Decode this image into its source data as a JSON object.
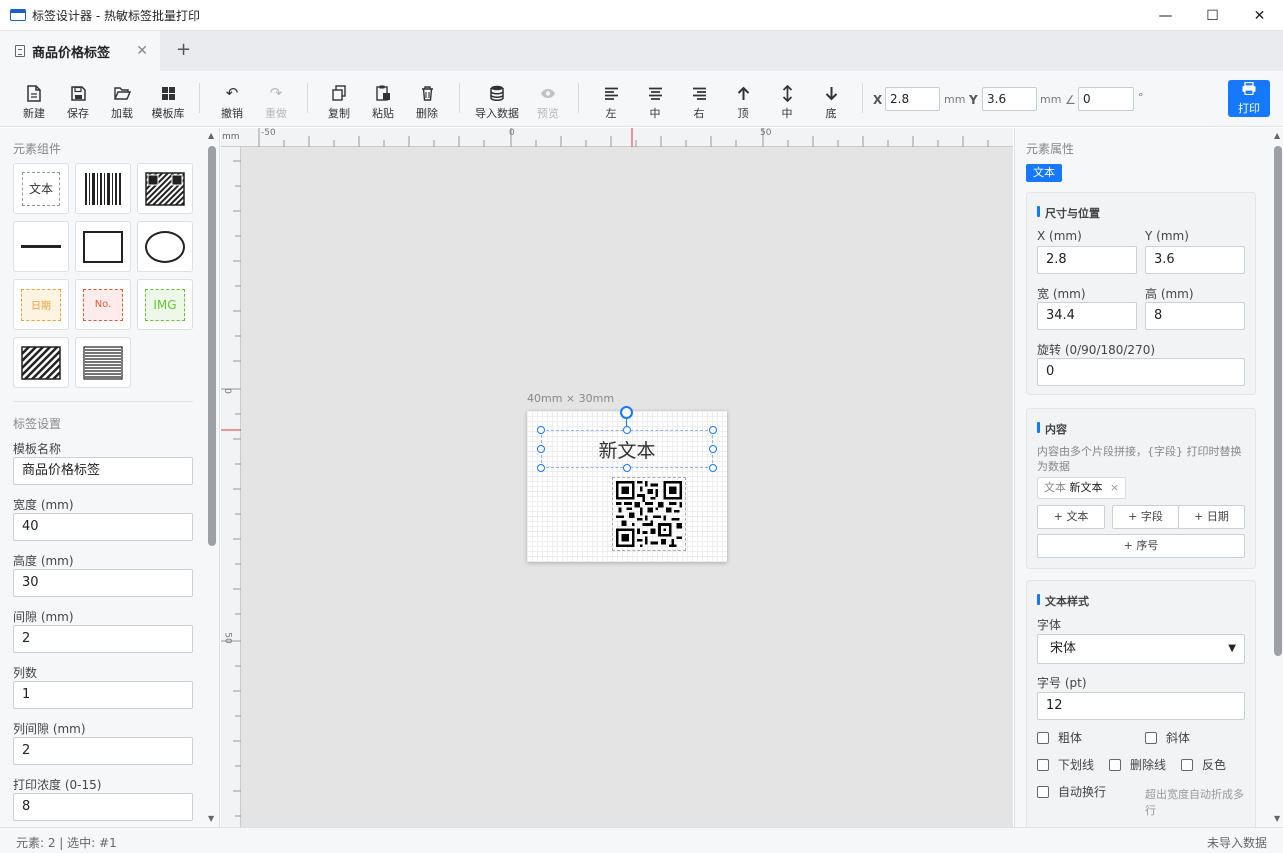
{
  "window": {
    "title": "标签设计器 - 热敏标签批量打印",
    "controls": [
      "—",
      "☐",
      "✕"
    ]
  },
  "tabs": {
    "active_label": "商品价格标签",
    "close_glyph": "✕",
    "add_glyph": "+"
  },
  "toolbar": {
    "new": "新建",
    "save": "保存",
    "load": "加载",
    "templates": "模板库",
    "undo": "撤销",
    "redo": "重做",
    "copy": "复制",
    "paste": "粘贴",
    "delete": "删除",
    "import_data": "导入数据",
    "preview": "预览",
    "align_left": "左",
    "align_center": "中",
    "align_right": "右",
    "align_top": "顶",
    "align_middle": "中",
    "align_bottom": "底",
    "x_label": "X",
    "x_value": "2.8",
    "x_unit": "mm",
    "y_label": "Y",
    "y_value": "3.6",
    "y_unit": "mm",
    "angle_symbol": "∠",
    "angle_value": "0",
    "angle_unit": "°",
    "print": "打印"
  },
  "left_panel": {
    "components_title": "元素组件",
    "comp_text": "文本",
    "comp_date": "日期",
    "comp_serial": "No.",
    "comp_image": "IMG",
    "settings_title": "标签设置",
    "template_name_label": "模板名称",
    "template_name_value": "商品价格标签",
    "width_label": "宽度 (mm)",
    "width_value": "40",
    "height_label": "高度 (mm)",
    "height_value": "30",
    "gap_label": "间隙 (mm)",
    "gap_value": "2",
    "columns_label": "列数",
    "columns_value": "1",
    "col_gap_label": "列间隙 (mm)",
    "col_gap_value": "2",
    "density_label": "打印浓度 (0-15)",
    "density_value": "8"
  },
  "canvas": {
    "ruler_unit": "mm",
    "ruler_top_ticks": [
      "-50",
      "0",
      "50"
    ],
    "ruler_left_ticks": [
      "0",
      "50"
    ],
    "label_size": "40mm × 30mm",
    "text_element": "新文本"
  },
  "right_panel": {
    "title": "元素属性",
    "type_badge": "文本",
    "pos_section": "尺寸与位置",
    "x_label": "X (mm)",
    "x_value": "2.8",
    "y_label": "Y (mm)",
    "y_value": "3.6",
    "w_label": "宽 (mm)",
    "w_value": "34.4",
    "h_label": "高 (mm)",
    "h_value": "8",
    "rot_label": "旋转 (0/90/180/270)",
    "rot_value": "0",
    "content_section": "内容",
    "content_hint": "内容由多个片段拼接，{字段} 打印时替换为数据",
    "chip_type": "文本",
    "chip_value": "新文本",
    "chip_close": "×",
    "add_text": "+ 文本",
    "add_field": "+ 字段",
    "add_date": "+ 日期",
    "add_serial": "+ 序号",
    "style_section": "文本样式",
    "font_label": "字体",
    "font_value": "宋体",
    "size_label": "字号 (pt)",
    "size_value": "12",
    "bold": "粗体",
    "italic": "斜体",
    "underline": "下划线",
    "strikethrough": "删除线",
    "invert": "反色",
    "autowrap": "自动换行",
    "autowrap_hint": "超出宽度自动折成多行"
  },
  "status": {
    "left": "元素: 2 | 选中: #1",
    "right": "未导入数据"
  },
  "colors": {
    "accent": "#1677ff",
    "date_border": "#e6a23c",
    "serial_border": "#e05a3a",
    "image_border": "#67c23a"
  }
}
